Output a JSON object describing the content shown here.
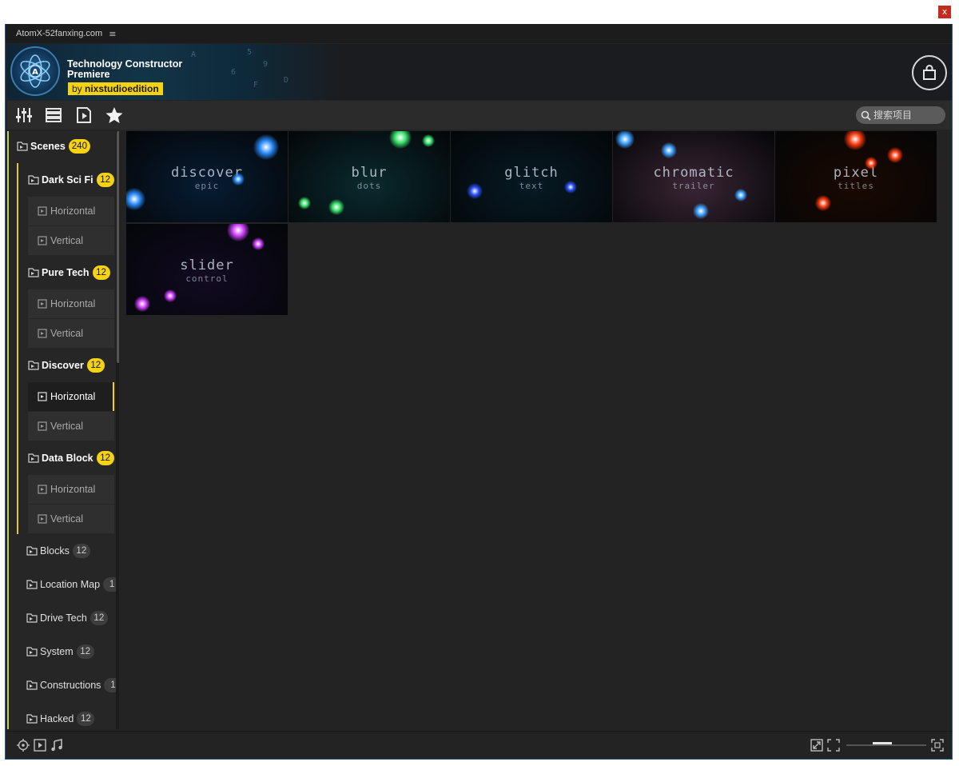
{
  "window": {
    "close_label": "x"
  },
  "panel": {
    "title": "AtomX-52fanxing.com",
    "menu_icon": "hamburger-icon"
  },
  "header": {
    "title_line1": "Technology Constructor",
    "title_line2": "Premiere",
    "badge_prefix": "by ",
    "badge_name": "nixstudioedition",
    "cart_icon": "shopping-bag-icon",
    "banner_digits": [
      "5",
      "9",
      "6",
      "A",
      "F",
      "D"
    ]
  },
  "toolbar": {
    "icons": [
      "sliders-icon",
      "list-icon",
      "video-file-icon",
      "star-icon"
    ],
    "search_placeholder": "搜索项目"
  },
  "sidebar": {
    "root": {
      "label": "Scenes",
      "count": "240"
    },
    "groups": [
      {
        "label": "Dark Sci Fi",
        "count": "12",
        "children": [
          "Horizontal",
          "Vertical"
        ]
      },
      {
        "label": "Pure Tech",
        "count": "12",
        "children": [
          "Horizontal",
          "Vertical"
        ]
      },
      {
        "label": "Discover",
        "count": "12",
        "children": [
          "Horizontal",
          "Vertical"
        ]
      },
      {
        "label": "Data Block",
        "count": "12",
        "children": [
          "Horizontal",
          "Vertical"
        ]
      }
    ],
    "collapsed": [
      {
        "label": "Blocks",
        "count": "12"
      },
      {
        "label": "Location Map",
        "count": "1"
      },
      {
        "label": "Drive Tech",
        "count": "12"
      },
      {
        "label": "System",
        "count": "12"
      },
      {
        "label": "Constructions",
        "count": "1"
      },
      {
        "label": "Hacked",
        "count": "12"
      }
    ],
    "active_group": "Discover",
    "active_child": "Horizontal"
  },
  "thumbnails": [
    {
      "title": "discover",
      "subtitle": "epic",
      "bg": "#071c33",
      "glow": "#2a8cff"
    },
    {
      "title": "blur",
      "subtitle": "dots",
      "bg": "#0a2a2e",
      "glow": "#38e06a"
    },
    {
      "title": "glitch",
      "subtitle": "text",
      "bg": "#061a24",
      "glow": "#2a50ff"
    },
    {
      "title": "chromatic",
      "subtitle": "trailer",
      "bg": "#3a2534",
      "glow": "#3aa0ff"
    },
    {
      "title": "pixel",
      "subtitle": "titles",
      "bg": "#1a0800",
      "glow": "#ff3a10"
    },
    {
      "title": "slider",
      "subtitle": "control",
      "bg": "#120a22",
      "glow": "#d040ff"
    }
  ],
  "bottom_bar": {
    "left_icons": [
      "target-icon",
      "play-box-icon",
      "music-note-icon"
    ],
    "right_icons": [
      "expand-icon",
      "fullscreen-icon",
      "fit-icon"
    ],
    "zoom_level": 0.45
  }
}
